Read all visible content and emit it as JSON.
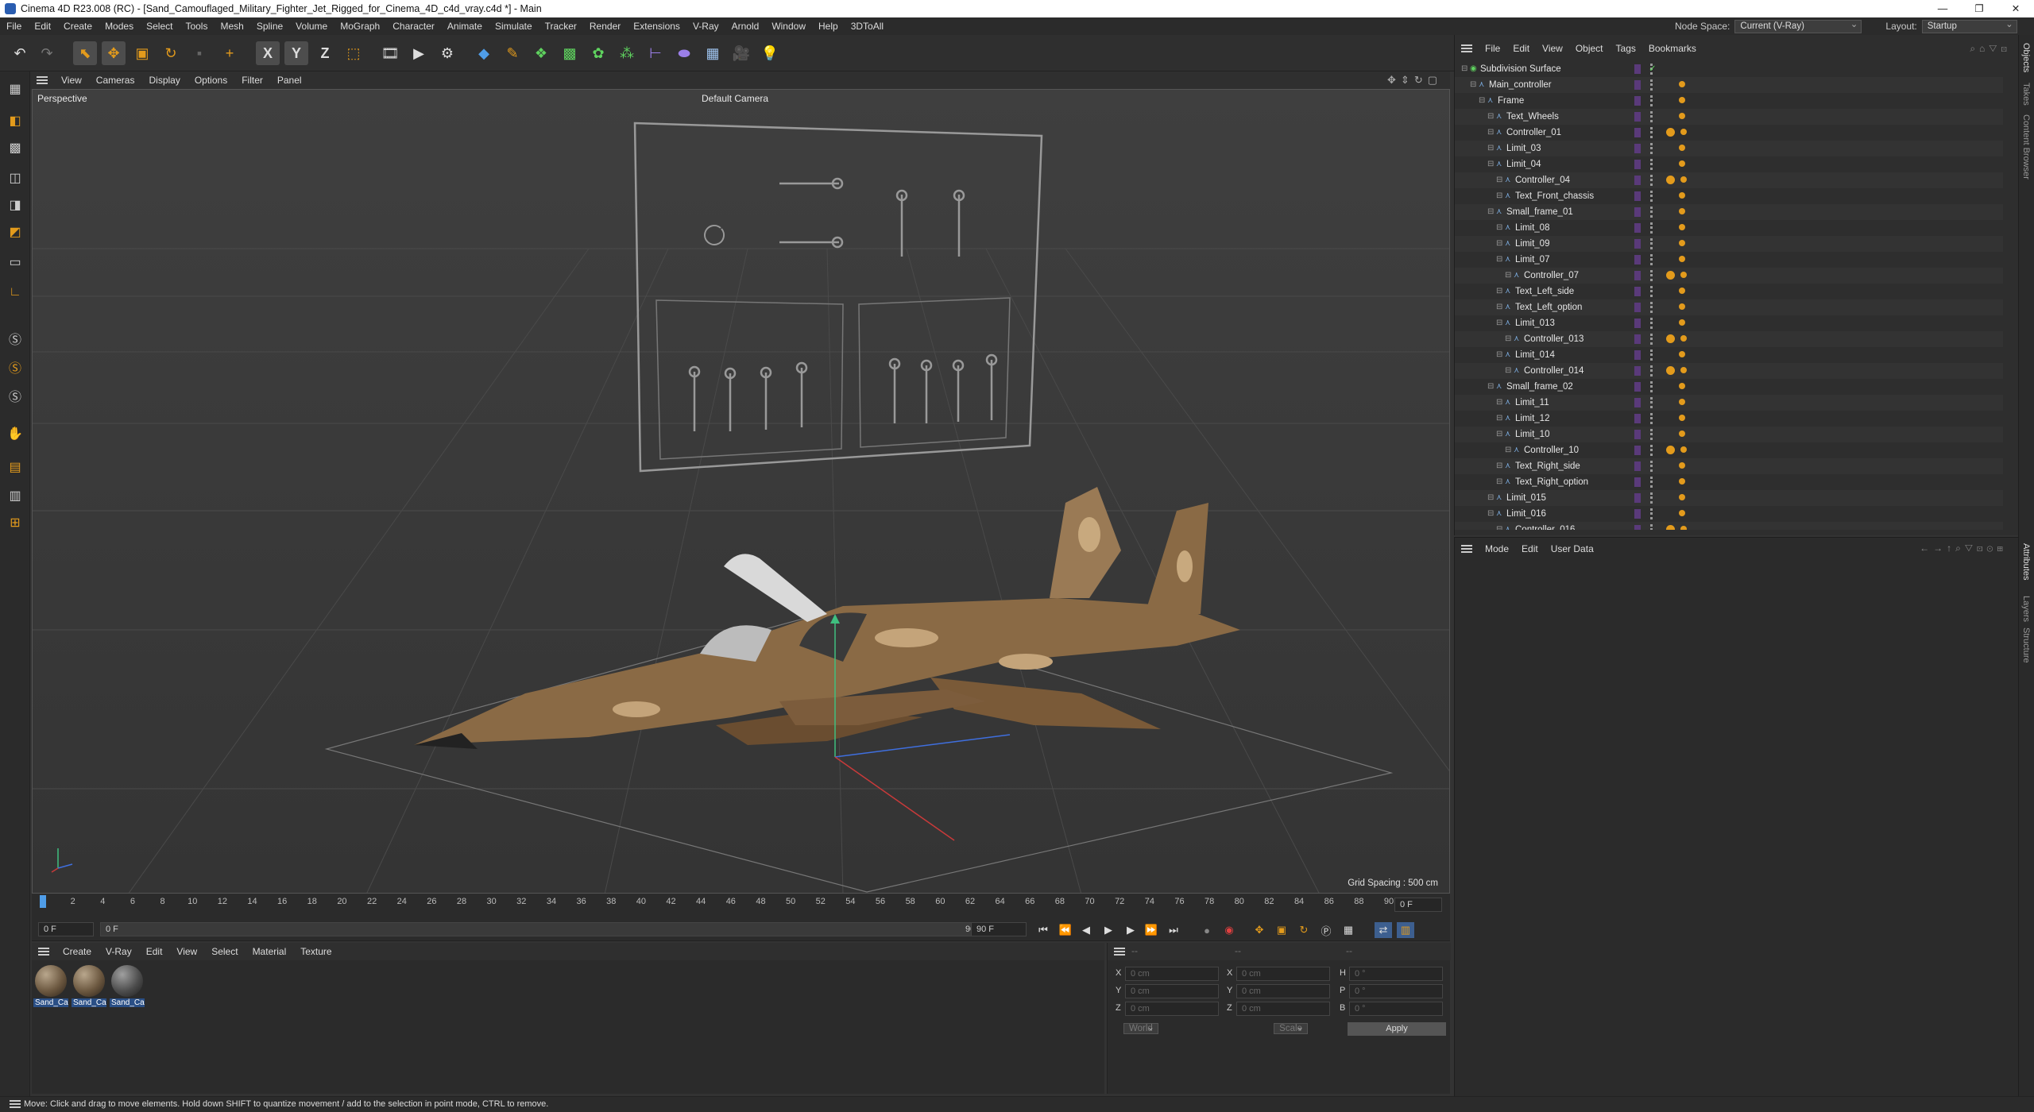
{
  "window": {
    "title": "Cinema 4D R23.008 (RC) - [Sand_Camouflaged_Military_Fighter_Jet_Rigged_for_Cinema_4D_c4d_vray.c4d *] - Main",
    "controls": [
      "—",
      "❐",
      "✕"
    ]
  },
  "menu": [
    "File",
    "Edit",
    "Create",
    "Modes",
    "Select",
    "Tools",
    "Mesh",
    "Spline",
    "Volume",
    "MoGraph",
    "Character",
    "Animate",
    "Simulate",
    "Tracker",
    "Render",
    "Extensions",
    "V-Ray",
    "Arnold",
    "Window",
    "Help",
    "3DToAll"
  ],
  "node_space": {
    "label": "Node Space:",
    "value": "Current (V-Ray)"
  },
  "layout": {
    "label": "Layout:",
    "value": "Startup"
  },
  "toolbar_icons": [
    "undo-icon",
    "redo-icon",
    "select-icon",
    "move-icon",
    "scale-icon",
    "rotate-icon",
    "recent-tool-icon",
    "add-icon",
    "x-axis-icon",
    "y-axis-icon",
    "z-axis-icon",
    "coordinate-system-icon",
    "render-region-icon",
    "render-view-icon",
    "render-settings-icon",
    "cube-icon",
    "pen-icon",
    "subdivision-icon",
    "extrude-icon",
    "cloner-icon",
    "mograph-icon",
    "deformer-icon",
    "field-icon",
    "camera-icon",
    "scene-icon",
    "light-icon"
  ],
  "toolbar_glyphs": {
    "x": "X",
    "y": "Y",
    "z": "Z"
  },
  "viewport": {
    "menu": [
      "View",
      "Cameras",
      "Display",
      "Options",
      "Filter",
      "Panel"
    ],
    "label": "Perspective",
    "camera": "Default Camera",
    "grid_spacing": "Grid Spacing : 500 cm"
  },
  "timeline": {
    "ticks": [
      0,
      2,
      4,
      6,
      8,
      10,
      12,
      14,
      16,
      18,
      20,
      22,
      24,
      26,
      28,
      30,
      32,
      34,
      36,
      38,
      40,
      42,
      44,
      46,
      48,
      50,
      52,
      54,
      56,
      58,
      60,
      62,
      64,
      66,
      68,
      70,
      72,
      74,
      76,
      78,
      80,
      82,
      84,
      86,
      88,
      90
    ],
    "current_frame": "0 F",
    "start": "0 F",
    "range_start": "0 F",
    "range_end": "90 F",
    "end": "90 F"
  },
  "materials": {
    "menu": [
      "Create",
      "V-Ray",
      "Edit",
      "View",
      "Select",
      "Material",
      "Texture"
    ],
    "items": [
      "Sand_Ca",
      "Sand_Ca",
      "Sand_Ca"
    ]
  },
  "coords": {
    "headers": [
      "--",
      "--",
      "--"
    ],
    "rows": [
      {
        "a": "X",
        "av": "0 cm",
        "b": "X",
        "bv": "0 cm",
        "c": "H",
        "cv": "0 °"
      },
      {
        "a": "Y",
        "av": "0 cm",
        "b": "Y",
        "bv": "0 cm",
        "c": "P",
        "cv": "0 °"
      },
      {
        "a": "Z",
        "av": "0 cm",
        "b": "Z",
        "bv": "0 cm",
        "c": "B",
        "cv": "0 °"
      }
    ],
    "mode1": "World",
    "mode2": "Scale",
    "apply": "Apply"
  },
  "objects": {
    "menu": [
      "File",
      "Edit",
      "View",
      "Object",
      "Tags",
      "Bookmarks"
    ],
    "tree": [
      {
        "name": "Subdivision Surface",
        "depth": 0,
        "tags": 0
      },
      {
        "name": "Main_controller",
        "depth": 1,
        "tags": 1
      },
      {
        "name": "Frame",
        "depth": 2,
        "tags": 1
      },
      {
        "name": "Text_Wheels",
        "depth": 3,
        "tags": 1
      },
      {
        "name": "Controller_01",
        "depth": 3,
        "tags": 2
      },
      {
        "name": "Limit_03",
        "depth": 3,
        "tags": 1
      },
      {
        "name": "Limit_04",
        "depth": 3,
        "tags": 1
      },
      {
        "name": "Controller_04",
        "depth": 4,
        "tags": 2
      },
      {
        "name": "Text_Front_chassis",
        "depth": 4,
        "tags": 1
      },
      {
        "name": "Small_frame_01",
        "depth": 3,
        "tags": 1
      },
      {
        "name": "Limit_08",
        "depth": 4,
        "tags": 1
      },
      {
        "name": "Limit_09",
        "depth": 4,
        "tags": 1
      },
      {
        "name": "Limit_07",
        "depth": 4,
        "tags": 1
      },
      {
        "name": "Controller_07",
        "depth": 5,
        "tags": 2
      },
      {
        "name": "Text_Left_side",
        "depth": 4,
        "tags": 1
      },
      {
        "name": "Text_Left_option",
        "depth": 4,
        "tags": 1
      },
      {
        "name": "Limit_013",
        "depth": 4,
        "tags": 1
      },
      {
        "name": "Controller_013",
        "depth": 5,
        "tags": 2
      },
      {
        "name": "Limit_014",
        "depth": 4,
        "tags": 1
      },
      {
        "name": "Controller_014",
        "depth": 5,
        "tags": 2
      },
      {
        "name": "Small_frame_02",
        "depth": 3,
        "tags": 1
      },
      {
        "name": "Limit_11",
        "depth": 4,
        "tags": 1
      },
      {
        "name": "Limit_12",
        "depth": 4,
        "tags": 1
      },
      {
        "name": "Limit_10",
        "depth": 4,
        "tags": 1
      },
      {
        "name": "Controller_10",
        "depth": 5,
        "tags": 2
      },
      {
        "name": "Text_Right_side",
        "depth": 4,
        "tags": 1
      },
      {
        "name": "Text_Right_option",
        "depth": 4,
        "tags": 1
      },
      {
        "name": "Limit_015",
        "depth": 3,
        "tags": 1
      },
      {
        "name": "Limit_016",
        "depth": 3,
        "tags": 1
      },
      {
        "name": "Controller_016",
        "depth": 4,
        "tags": 2
      }
    ]
  },
  "attributes": {
    "menu": [
      "Mode",
      "Edit",
      "User Data"
    ]
  },
  "right_tabs": [
    "Objects",
    "Takes",
    "Content Browser",
    "Attributes",
    "Layers",
    "Structure"
  ],
  "status": "Move: Click and drag to move elements. Hold down SHIFT to quantize movement / add to the selection in point mode, CTRL to remove.",
  "colors": {
    "accent": "#e39b1c",
    "selection": "#2a4f86",
    "bg": "#333333"
  }
}
